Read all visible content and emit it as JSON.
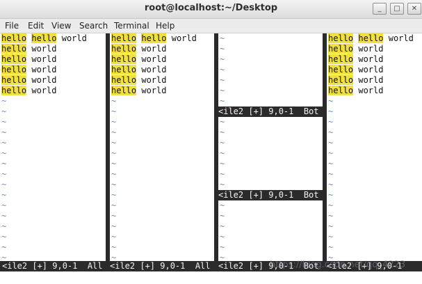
{
  "window": {
    "title": "root@localhost:~/Desktop",
    "minimize": "_",
    "maximize": "□",
    "close": "✕"
  },
  "menu": [
    "File",
    "Edit",
    "View",
    "Search",
    "Terminal",
    "Help"
  ],
  "buffer": {
    "first_line_words": [
      "hello",
      "hello",
      "world"
    ],
    "line_text": [
      "hello",
      "world"
    ],
    "tilde": "~"
  },
  "panes": {
    "status_left": "<ile2 [+] 9,0-1  All",
    "status_mid_top": "<ile2 [+] 9,0-1  Bot",
    "status_mid_bottom": "<ile2 [+] 9,0-1  Bot",
    "status_bottom_3": "<ile2 [+] 9,0-1  Bot",
    "status_bottom_4": "<ile2 [+] 9,0-1"
  },
  "watermark": "https://blog.csdn.net/qq_4223"
}
